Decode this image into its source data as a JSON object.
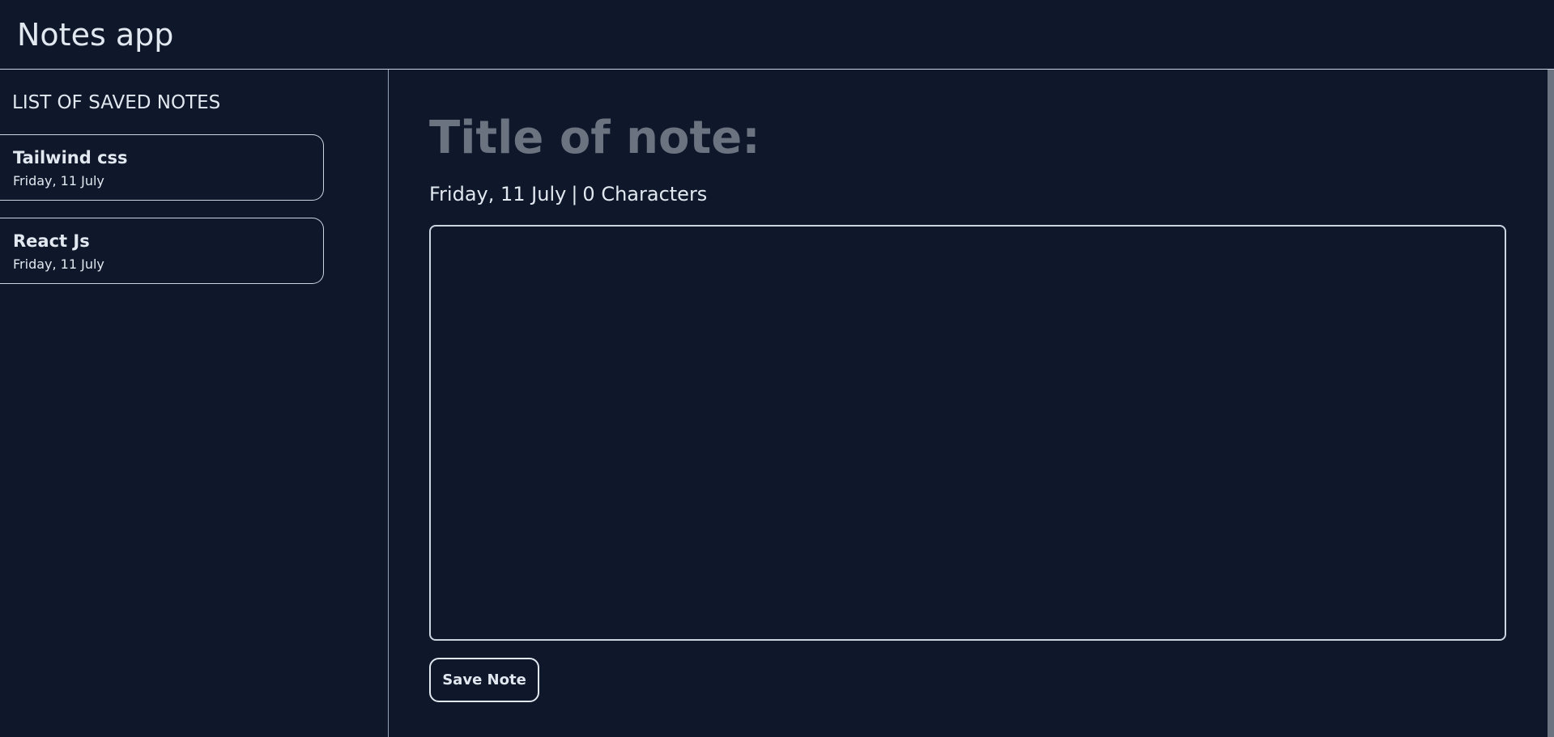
{
  "app": {
    "title": "Notes app"
  },
  "sidebar": {
    "heading": "LIST OF SAVED NOTES",
    "notes": [
      {
        "title": "Tailwind css",
        "date": "Friday, 11 July"
      },
      {
        "title": "React Js",
        "date": "Friday, 11 July"
      }
    ]
  },
  "editor": {
    "title_placeholder": "Title of note:",
    "title_value": "",
    "date": "Friday, 11 July",
    "separator": "|",
    "char_count": "0 Characters",
    "body_value": "",
    "save_label": "Save Note"
  },
  "colors": {
    "background": "#0f172a",
    "text": "#e2e8f0",
    "border": "#cbd5e1",
    "placeholder": "#6b7280"
  }
}
